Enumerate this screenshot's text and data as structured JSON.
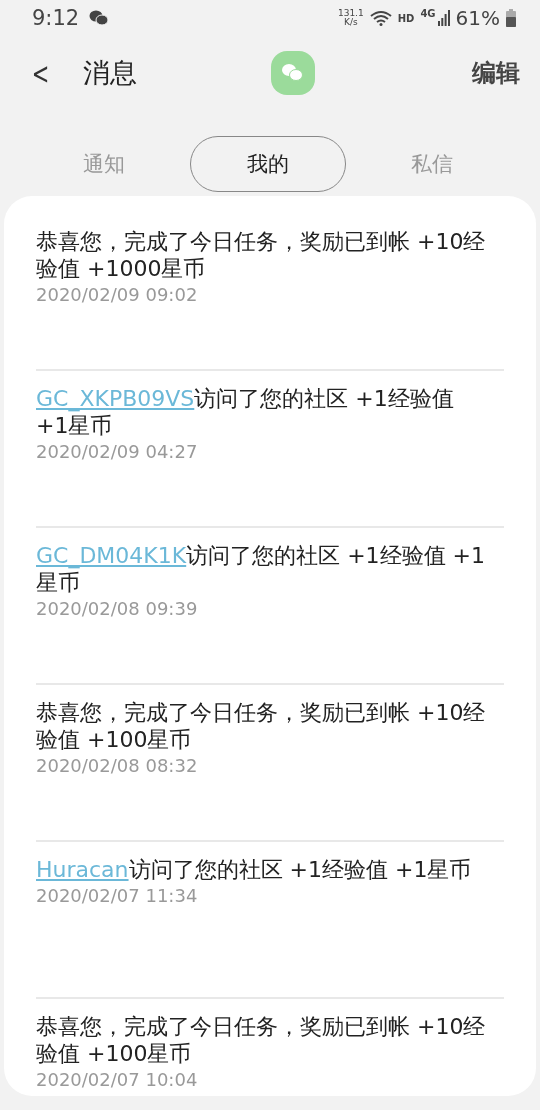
{
  "status_bar": {
    "time": "9:12",
    "net_speed": "131.1",
    "net_unit": "K/s",
    "hd": "HD",
    "network": "4G",
    "battery": "61%"
  },
  "header": {
    "back": "<",
    "title": "消息",
    "action": "编辑"
  },
  "tabs": [
    {
      "label": "通知",
      "selected": false
    },
    {
      "label": "我的",
      "selected": true
    },
    {
      "label": "私信",
      "selected": false
    }
  ],
  "messages": [
    {
      "text": "恭喜您，完成了今日任务，奖励已到帐 +10经验值 +1000星币",
      "date": "2020/02/09 09:02"
    },
    {
      "user": "GC_XKPB09VS",
      "text": "访问了您的社区 +1经验值 +1星币",
      "date": "2020/02/09 04:27"
    },
    {
      "user": "GC_DM04K1K",
      "text": "访问了您的社区 +1经验值 +1星币",
      "date": "2020/02/08 09:39"
    },
    {
      "text": "恭喜您，完成了今日任务，奖励已到帐 +10经验值 +100星币",
      "date": "2020/02/08 08:32"
    },
    {
      "user": "Huracan",
      "text": "访问了您的社区 +1经验值 +1星币",
      "date": "2020/02/07 11:34"
    },
    {
      "text": "恭喜您，完成了今日任务，奖励已到帐 +10经验值 +100星币",
      "date": "2020/02/07 10:04"
    }
  ]
}
